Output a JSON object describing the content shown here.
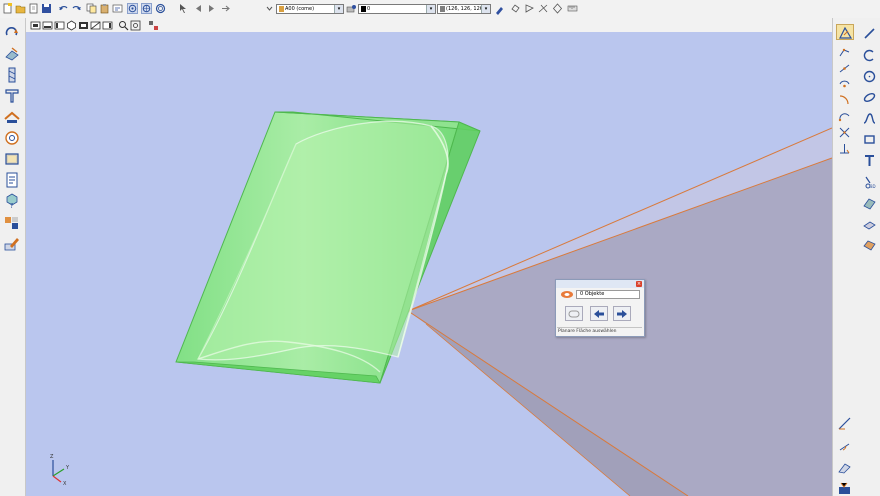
{
  "toolbar": {
    "layer_combo": "A00 (come)",
    "color_combo": "0",
    "rgb_combo": "(126, 126, 126)"
  },
  "dialog": {
    "object_count": "0 Objekte",
    "status_text": "Planare Fläche auswählen"
  },
  "axes": {
    "x": "X",
    "y": "Y",
    "z": "Z"
  },
  "colors": {
    "viewport_bg": "#bac6ee",
    "solid_green": "#70e670",
    "floor": "#aaa9c4",
    "edge_orange": "#d97a3c"
  }
}
